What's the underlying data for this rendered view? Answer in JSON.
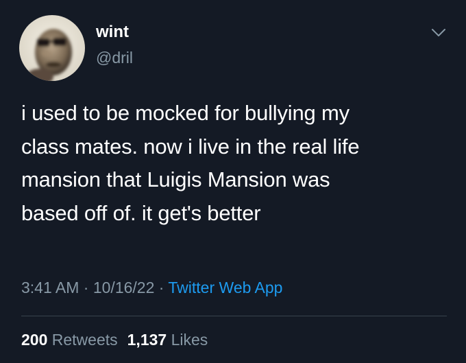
{
  "colors": {
    "background": "#141a25",
    "text_primary": "#ffffff",
    "text_secondary": "#8899a6",
    "link": "#1d9bf0",
    "divider": "#38444d"
  },
  "author": {
    "display_name": "wint",
    "handle": "@dril",
    "avatar_icon": "avatar-photo"
  },
  "menu": {
    "icon": "chevron-down-icon"
  },
  "tweet": {
    "lines": [
      "i used to be mocked for bullying my",
      "class mates. now i live in the real life",
      "mansion that Luigis Mansion was",
      "based off of. it get's better"
    ]
  },
  "meta": {
    "time": "3:41 AM",
    "separator": " · ",
    "date": "10/16/22",
    "source": "Twitter Web App"
  },
  "stats": {
    "retweets_count": "200",
    "retweets_label": "Retweets",
    "likes_count": "1,137",
    "likes_label": "Likes"
  }
}
